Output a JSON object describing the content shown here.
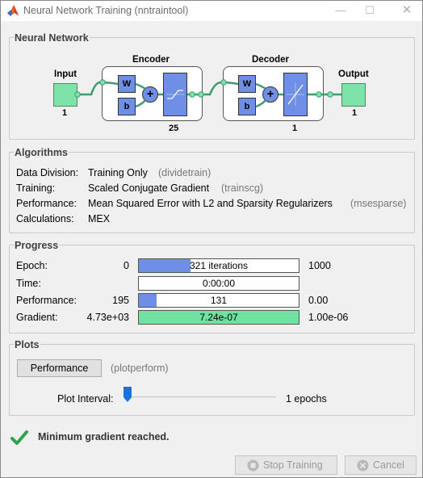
{
  "window": {
    "title": "Neural Network Training (nntraintool)"
  },
  "neural_network": {
    "section_title": "Neural Network",
    "input_label": "Input",
    "input_size": "1",
    "encoder_label": "Encoder",
    "encoder_size": "25",
    "decoder_label": "Decoder",
    "decoder_size": "1",
    "output_label": "Output",
    "output_size": "1",
    "weight_symbol": "W",
    "bias_symbol": "b",
    "sum_symbol": "+"
  },
  "algorithms": {
    "section_title": "Algorithms",
    "rows": [
      {
        "label": "Data Division:",
        "value": "Training Only",
        "fn": "(dividetrain)"
      },
      {
        "label": "Training:",
        "value": "Scaled Conjugate Gradient",
        "fn": "(trainscg)"
      },
      {
        "label": "Performance:",
        "value": "Mean Squared Error with L2 and Sparsity Regularizers",
        "fn": "(msesparse)"
      },
      {
        "label": "Calculations:",
        "value": "MEX",
        "fn": ""
      }
    ]
  },
  "progress": {
    "section_title": "Progress",
    "epoch": {
      "label": "Epoch:",
      "start": "0",
      "current": "321 iterations",
      "end": "1000",
      "fraction": 0.321
    },
    "time": {
      "label": "Time:",
      "start": "",
      "current": "0:00:00",
      "end": "",
      "fraction": 0
    },
    "performance": {
      "label": "Performance:",
      "start": "195",
      "current": "131",
      "end": "0.00",
      "fraction": 0.11
    },
    "gradient": {
      "label": "Gradient:",
      "start": "4.73e+03",
      "current": "7.24e-07",
      "end": "1.00e-06",
      "fraction": 1.0
    }
  },
  "plots": {
    "section_title": "Plots",
    "performance_button": "Performance",
    "performance_fn": "(plotperform)",
    "interval_label": "Plot Interval:",
    "interval_value": "1 epochs",
    "interval_fraction": 0
  },
  "status": {
    "message": "Minimum gradient reached."
  },
  "buttons": {
    "stop_training": "Stop Training",
    "cancel": "Cancel"
  },
  "colors": {
    "progress_blue": "#6f8ee6",
    "gradient_green": "#6ee2a0",
    "io_green": "#7ee3a8",
    "layer_blue": "#6f8ee6"
  }
}
